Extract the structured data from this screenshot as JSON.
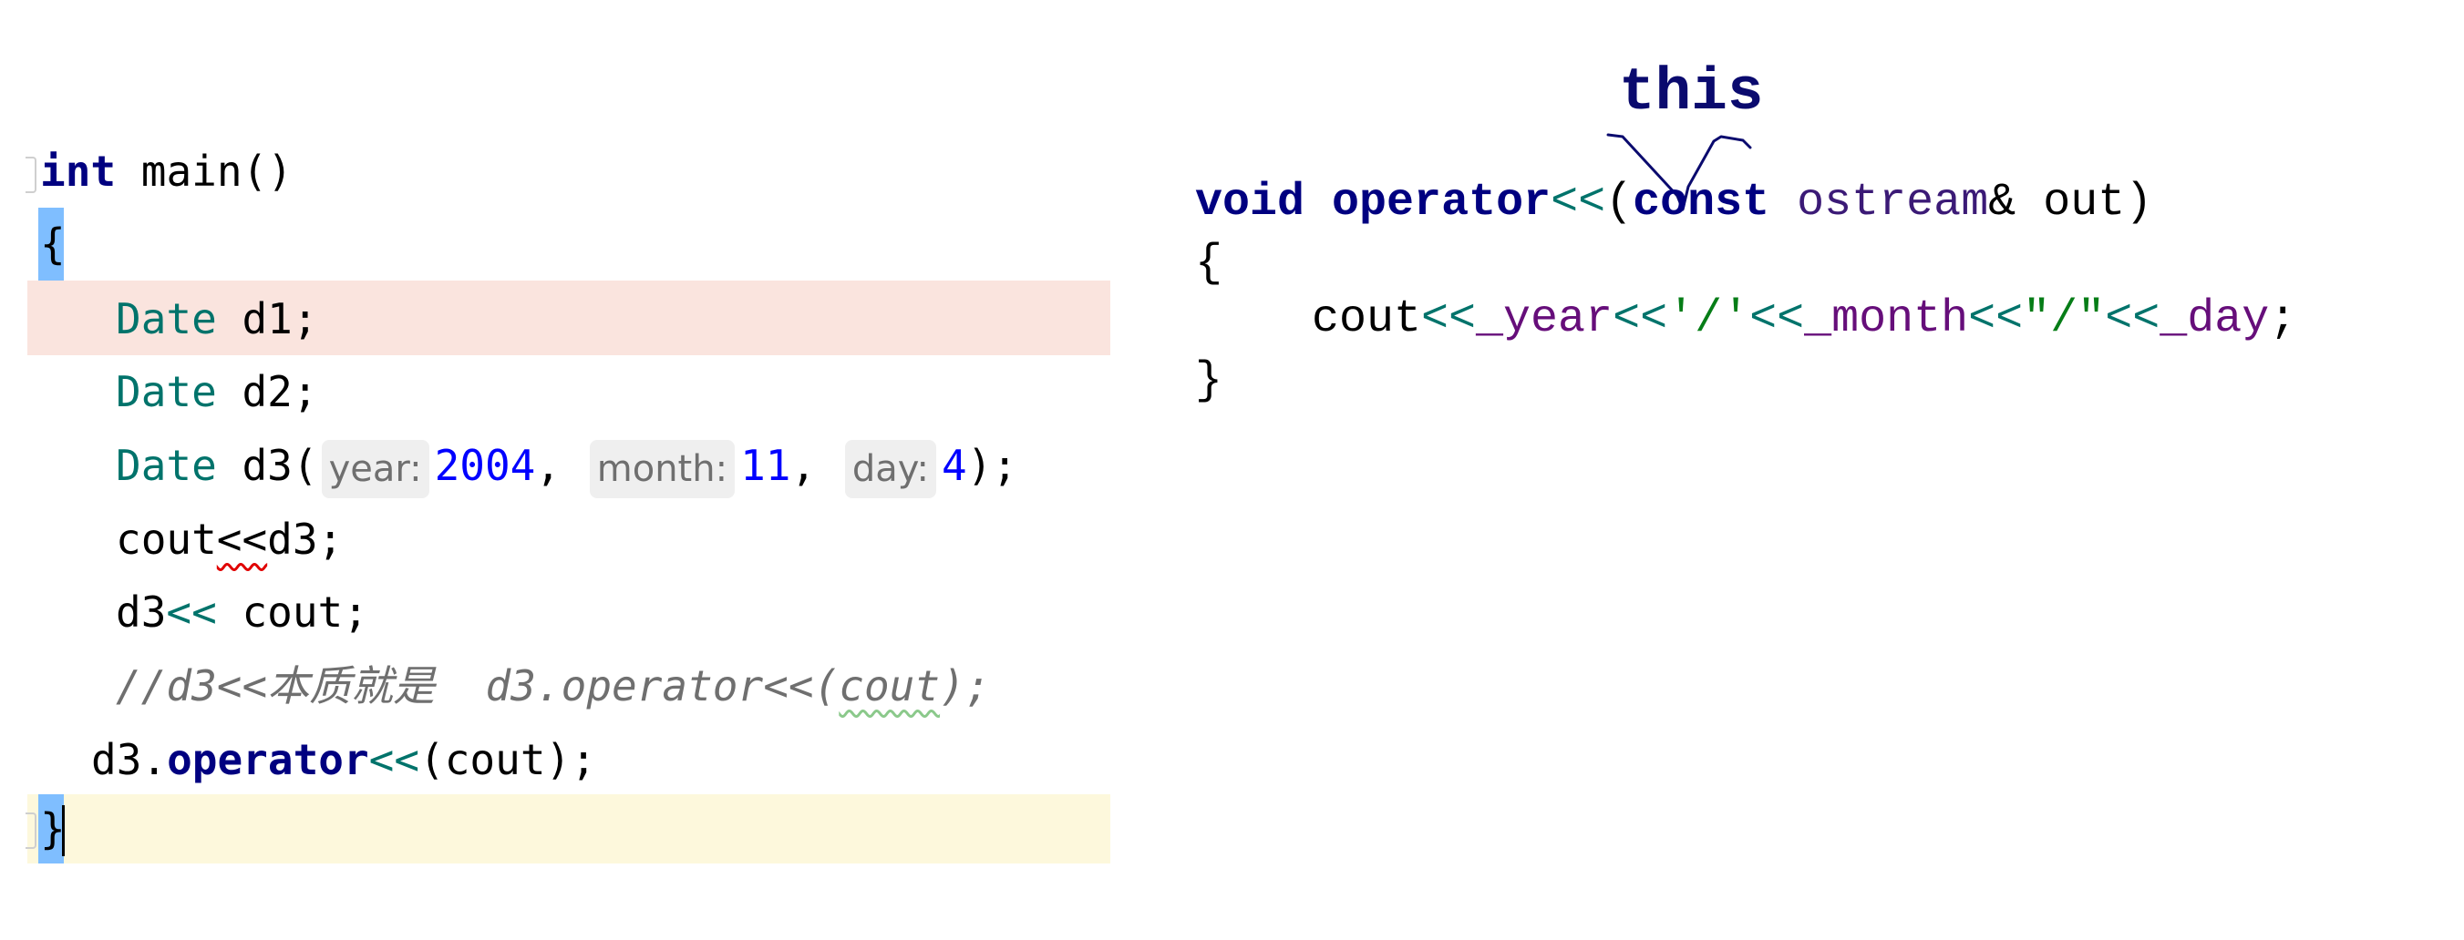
{
  "left_editor": {
    "lines": {
      "l1": {
        "kw": "int",
        "rest": " main()"
      },
      "l2": {
        "text": "{"
      },
      "l3": {
        "type": "Date",
        "rest": " d1;"
      },
      "l4": {
        "type": "Date",
        "rest": " d2;"
      },
      "l5": {
        "type": "Date",
        "pre": " d3(",
        "hint_year": "year:",
        "val_year": "2004",
        "sep1": ", ",
        "hint_month": "month:",
        "val_month": "11",
        "sep2": ", ",
        "hint_day": "day:",
        "val_day": "4",
        "post": ");"
      },
      "l6": {
        "a": "cout",
        "op": "<<",
        "b": "d3;"
      },
      "l7": {
        "a": "d3",
        "op": "<<",
        "b": " cout;"
      },
      "l8": {
        "pre": "//d3<<本质就是  d3.operator<<(",
        "squig": "cout",
        "post": ");"
      },
      "l9": {
        "a": "d3.",
        "kw": "operator",
        "op": "<<",
        "b": "(cout);"
      },
      "l10": {
        "text": "}"
      }
    }
  },
  "right_snippet": {
    "annotation": "this",
    "lines": {
      "r1": {
        "kw1": "void",
        "sp": " ",
        "kw2": "operator",
        "op": "<<",
        "paren": "(",
        "kw3": "const",
        "type": " ostream",
        "rest": "& out)"
      },
      "r2": {
        "text": "{"
      },
      "r3": {
        "a": "cout",
        "op1": "<<",
        "m1": "_year",
        "op2": "<<",
        "s1": "'/'",
        "op3": "<<",
        "m2": "_month",
        "op4": "<<",
        "s2": "\"/\"",
        "op5": "<<",
        "m3": "_day",
        "end": ";"
      },
      "r4": {
        "text": "}"
      }
    }
  }
}
